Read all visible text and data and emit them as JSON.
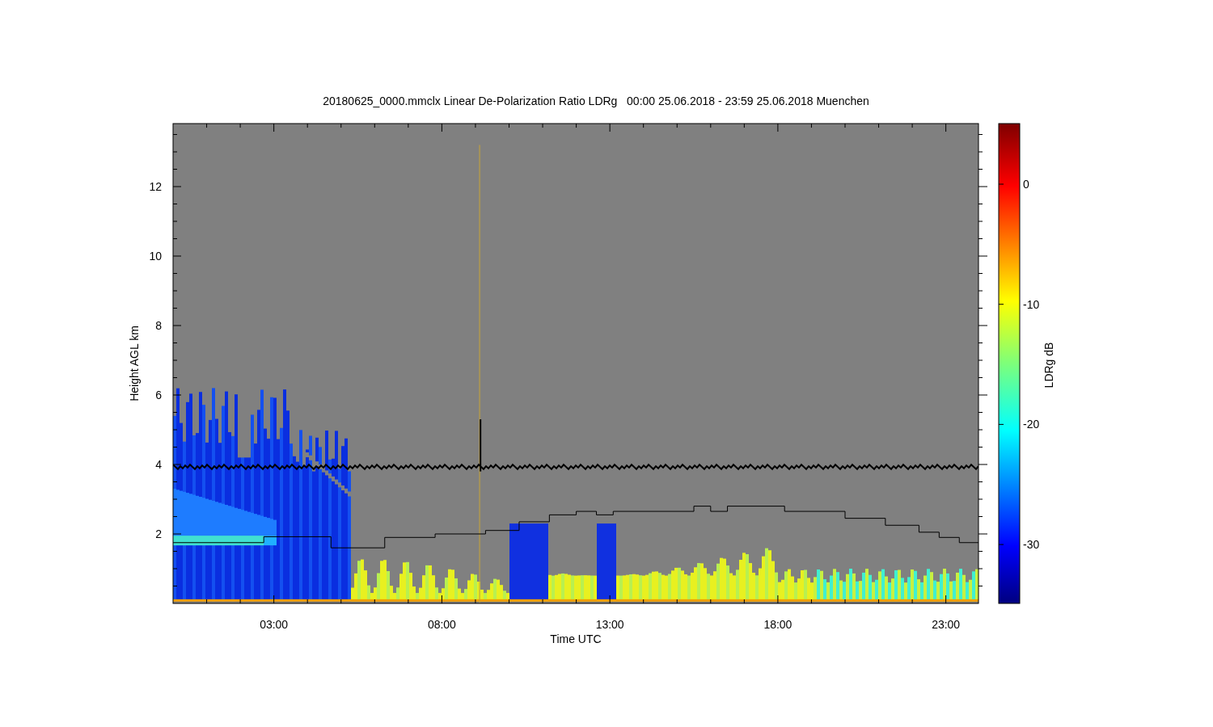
{
  "title": "20180625_0000.mmclx Linear De-Polarization Ratio LDRg   00:00 25.06.2018 - 23:59 25.06.2018 Muenchen",
  "y_axis": {
    "label": "Height AGL km",
    "ticks": [
      "12",
      "10",
      "8",
      "6",
      "4",
      "2"
    ]
  },
  "x_axis": {
    "label": "Time UTC",
    "ticks": [
      "03:00",
      "08:00",
      "13:00",
      "18:00",
      "23:00"
    ]
  },
  "colorbar": {
    "label": "LDRg dB",
    "ticks": [
      "0",
      "-10",
      "-20",
      "-30"
    ]
  }
}
